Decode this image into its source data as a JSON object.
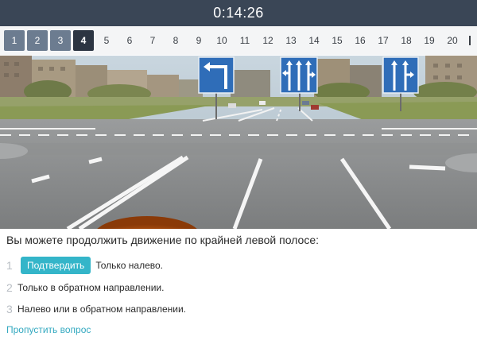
{
  "timer": "0:14:26",
  "nav": {
    "numbers": [
      "1",
      "2",
      "3",
      "4",
      "5",
      "6",
      "7",
      "8",
      "9",
      "10",
      "11",
      "12",
      "13",
      "14",
      "15",
      "16",
      "17",
      "18",
      "19",
      "20",
      ""
    ],
    "done": [
      "1",
      "2",
      "3"
    ],
    "current": "4"
  },
  "question": {
    "text": "Вы можете продолжить движение по крайней левой полосе:",
    "answers": [
      {
        "number": "1",
        "text": "Только налево.",
        "confirm_label": "Подтвердить"
      },
      {
        "number": "2",
        "text": "Только в обратном направлении."
      },
      {
        "number": "3",
        "text": "Налево или в обратном направлении."
      }
    ],
    "skip_label": "Пропустить вопрос"
  }
}
